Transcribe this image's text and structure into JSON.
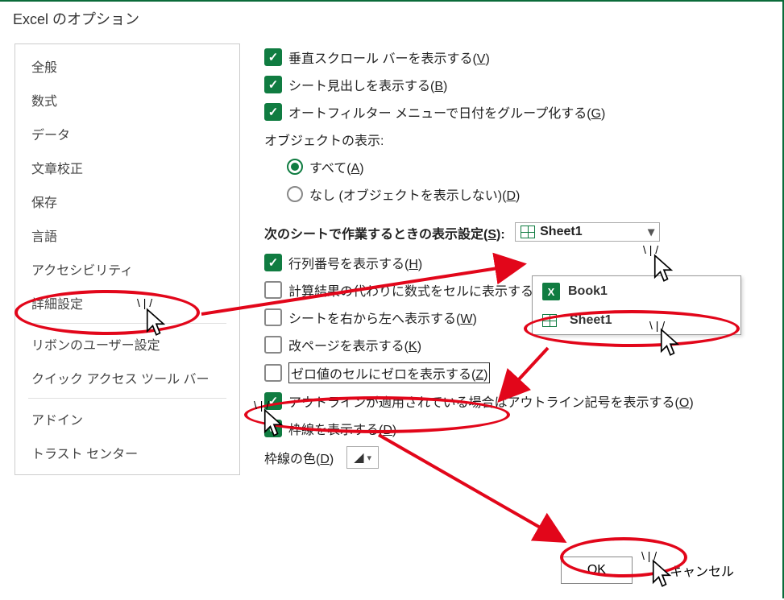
{
  "title": "Excel のオプション",
  "sidebar": {
    "items": [
      {
        "label": "全般"
      },
      {
        "label": "数式"
      },
      {
        "label": "データ"
      },
      {
        "label": "文章校正"
      },
      {
        "label": "保存"
      },
      {
        "label": "言語"
      },
      {
        "label": "アクセシビリティ"
      },
      {
        "label": "詳細設定"
      },
      {
        "label": "リボンのユーザー設定"
      },
      {
        "label": "クイック アクセス ツール バー"
      },
      {
        "label": "アドイン"
      },
      {
        "label": "トラスト センター"
      }
    ]
  },
  "top_checks": [
    {
      "label_pre": "垂直スクロール バーを表示する(",
      "accel": "V",
      "label_post": ")",
      "checked": true
    },
    {
      "label_pre": "シート見出しを表示する(",
      "accel": "B",
      "label_post": ")",
      "checked": true
    },
    {
      "label_pre": "オートフィルター メニューで日付をグループ化する(",
      "accel": "G",
      "label_post": ")",
      "checked": true
    }
  ],
  "objects": {
    "heading": "オブジェクトの表示:",
    "radios": [
      {
        "label_pre": "すべて(",
        "accel": "A",
        "label_post": ")",
        "on": true
      },
      {
        "label_pre": "なし (オブジェクトを表示しない)(",
        "accel": "D",
        "label_post": ")",
        "on": false
      }
    ]
  },
  "section": {
    "head_pre": "次のシートで作業するときの表示設定(",
    "head_accel": "S",
    "head_post": "):",
    "dropdown_value": "Sheet1",
    "dropdown_items": [
      {
        "icon": "excel",
        "label": "Book1"
      },
      {
        "icon": "sheet",
        "label": "Sheet1"
      }
    ],
    "checks": [
      {
        "label_pre": "行列番号を表示する(",
        "accel": "H",
        "label_post": ")",
        "checked": true
      },
      {
        "label_pre": "計算結果の代わりに数式をセルに表示する(",
        "accel": "R",
        "label_post": ")",
        "checked": false,
        "truncated": true
      },
      {
        "label_pre": "シートを右から左へ表示する(",
        "accel": "W",
        "label_post": ")",
        "checked": false
      },
      {
        "label_pre": "改ページを表示する(",
        "accel": "K",
        "label_post": ")",
        "checked": false
      },
      {
        "label_pre": "ゼロ値のセルにゼロを表示する(",
        "accel": "Z",
        "label_post": ")",
        "checked": false,
        "boxed": true
      },
      {
        "label_pre": "アウトラインが適用されている場合はアウトライン記号を表示する(",
        "accel": "O",
        "label_post": ")",
        "checked": true
      },
      {
        "label_pre": "枠線を表示する(",
        "accel": "D",
        "label_post": ")",
        "checked": true
      }
    ],
    "border_color_pre": "枠線の色(",
    "border_color_accel": "D",
    "border_color_post": ")"
  },
  "footer": {
    "ok": "OK",
    "cancel": "キャンセル"
  }
}
